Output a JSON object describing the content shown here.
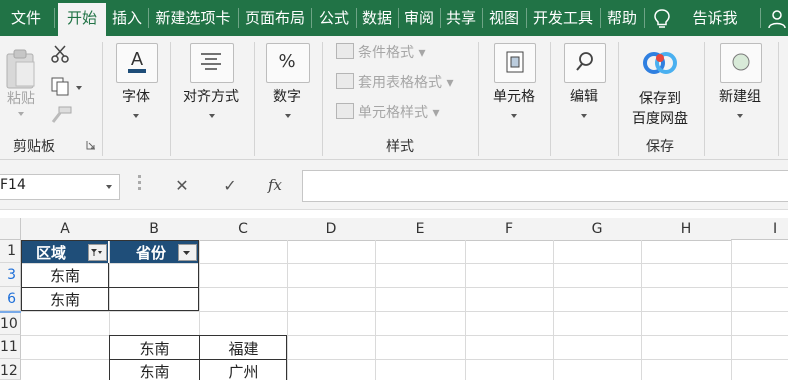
{
  "menu": {
    "tabs": [
      "文件",
      "开始",
      "插入",
      "新建选项卡",
      "页面布局",
      "公式",
      "数据",
      "审阅",
      "共享",
      "视图",
      "开发工具",
      "帮助"
    ],
    "tell_me": "告诉我",
    "active_tab": "开始"
  },
  "ribbon": {
    "paste_label": "粘贴",
    "clipboard_group": "剪贴板",
    "font_label": "字体",
    "align_label": "对齐方式",
    "number_label": "数字",
    "number_glyph": "%",
    "conditional_format": "条件格式",
    "table_format": "套用表格格式",
    "cell_style": "单元格样式",
    "styles_group": "样式",
    "cells_label": "单元格",
    "edit_label": "编辑",
    "save_to_baidu_line1": "保存到",
    "save_to_baidu_line2": "百度网盘",
    "save_group": "保存",
    "new_group_label": "新建组"
  },
  "formula_bar": {
    "name_box": "F14",
    "cancel_glyph": "✕",
    "enter_glyph": "✓",
    "fx_glyph": "fx",
    "formula": ""
  },
  "sheet": {
    "columns": [
      "A",
      "B",
      "C",
      "D",
      "E",
      "F",
      "G",
      "H",
      "I"
    ],
    "rows": [
      "1",
      "3",
      "6",
      "10",
      "11",
      "12"
    ],
    "header": {
      "a1": "区域",
      "b1": "省份"
    },
    "cells": {
      "a3": "东南",
      "a6": "东南",
      "b11": "东南",
      "c11": "福建",
      "b12": "东南",
      "c12": "广州"
    }
  },
  "colors": {
    "excel_green": "#217346",
    "header_fill": "#1f4e79",
    "filtered_row_number": "#1e6fd9"
  }
}
